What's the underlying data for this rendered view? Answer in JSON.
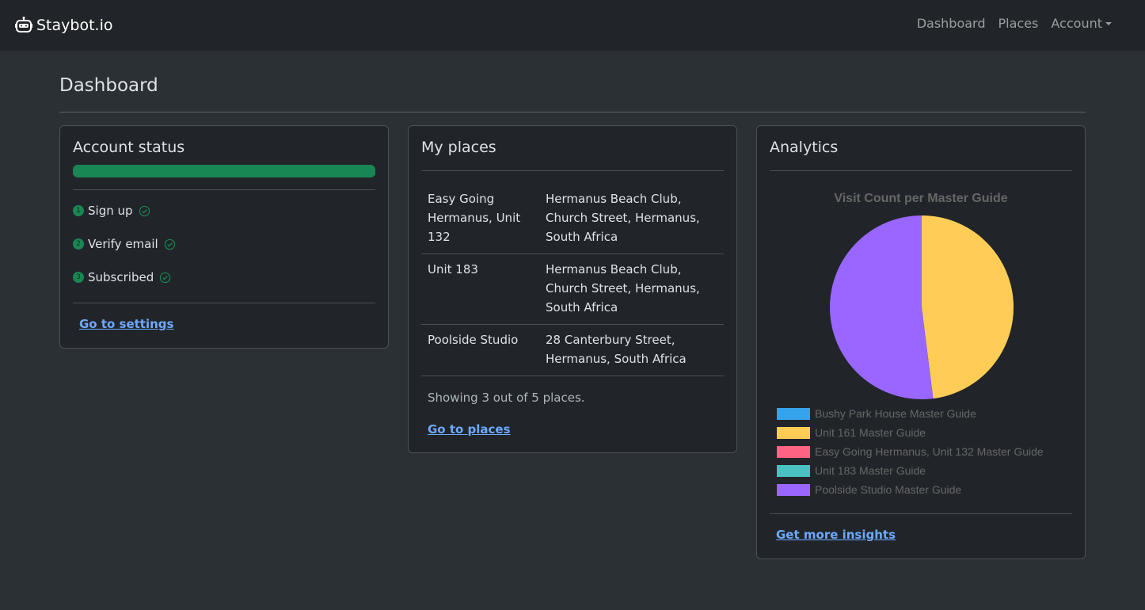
{
  "navbar": {
    "brand": "Staybot.io",
    "links": [
      "Dashboard",
      "Places",
      "Account"
    ]
  },
  "page": {
    "title": "Dashboard"
  },
  "account_status": {
    "title": "Account status",
    "progress_percent": 100,
    "steps": [
      {
        "num": "1",
        "label": "Sign up"
      },
      {
        "num": "2",
        "label": "Verify email"
      },
      {
        "num": "3",
        "label": "Subscribed"
      }
    ],
    "settings_link": "Go to settings"
  },
  "places": {
    "title": "My places",
    "rows": [
      {
        "name": "Easy Going Hermanus, Unit 132",
        "address": "Hermanus Beach Club, Church Street, Hermanus, South Africa"
      },
      {
        "name": "Unit 183",
        "address": "Hermanus Beach Club, Church Street, Hermanus, South Africa"
      },
      {
        "name": "Poolside Studio",
        "address": "28 Canterbury Street, Hermanus, South Africa"
      }
    ],
    "summary": "Showing 3 out of 5 places.",
    "link": "Go to places"
  },
  "analytics": {
    "title": "Analytics",
    "link": "Get more insights"
  },
  "chart_data": {
    "type": "pie",
    "title": "Visit Count per Master Guide",
    "categories": [
      "Bushy Park House Master Guide",
      "Unit 161 Master Guide",
      "Easy Going Hermanus, Unit 132 Master Guide",
      "Unit 183 Master Guide",
      "Poolside Studio Master Guide"
    ],
    "values": [
      0,
      48,
      0,
      0,
      52
    ],
    "colors": [
      "#36a2eb",
      "#ffcd56",
      "#ff6384",
      "#4bc0c0",
      "#9966ff"
    ],
    "legend": "bottom"
  }
}
